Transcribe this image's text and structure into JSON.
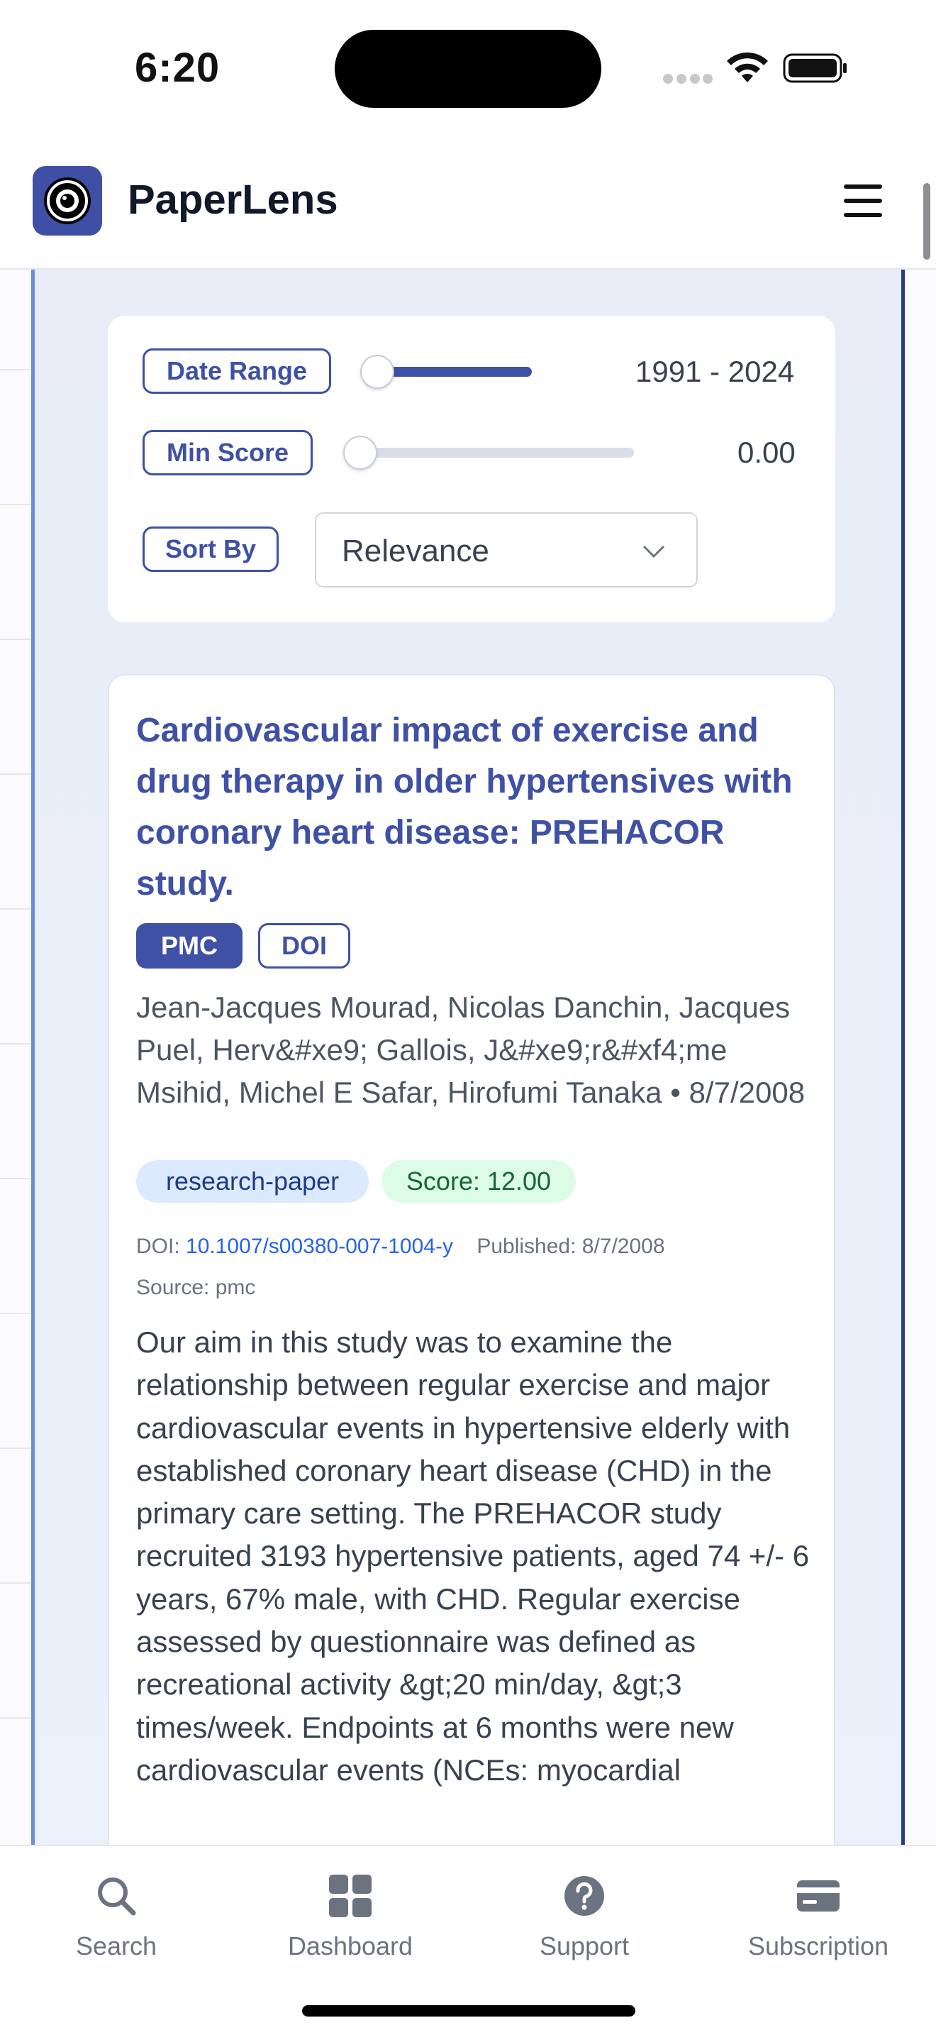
{
  "status_bar": {
    "time": "6:20"
  },
  "app": {
    "title": "PaperLens"
  },
  "filters": {
    "date_range": {
      "label": "Date Range",
      "value": "1991 - 2024",
      "min_fraction": 0.0,
      "max_fraction": 1.0
    },
    "min_score": {
      "label": "Min Score",
      "value": "0.00",
      "fraction": 0.0
    },
    "sort_by": {
      "label": "Sort By",
      "selected": "Relevance"
    }
  },
  "result": {
    "title": "Cardiovascular impact of exercise and drug therapy in older hypertensives with coronary heart disease: PREHACOR study.",
    "badges": {
      "primary": "PMC",
      "secondary": "DOI"
    },
    "authors": "Jean-Jacques Mourad, Nicolas Danchin, Jacques Puel, Herv&#xe9; Gallois, J&#xe9;r&#xf4;me Msihid, Michel E Safar, Hirofumi Tanaka • 8/7/2008",
    "tags": {
      "type": "research-paper",
      "score": "Score: 12.00"
    },
    "meta": {
      "doi_label": "DOI:",
      "doi_value": "10.1007/s00380-007-1004-y",
      "published": "Published: 8/7/2008",
      "source": "Source: pmc"
    },
    "abstract": "Our aim in this study was to examine the relationship between regular exercise and major cardiovascular events in hypertensive elderly with established coronary heart disease (CHD) in the primary care setting. The PREHACOR study recruited 3193 hypertensive patients, aged 74 +/- 6 years, 67% male, with CHD. Regular exercise assessed by questionnaire was defined as recreational activity &gt;20 min/day, &gt;3 times/week. Endpoints at 6 months were new cardiovascular events (NCEs: myocardial"
  },
  "tabbar": {
    "items": [
      {
        "label": "Search",
        "icon": "search-icon"
      },
      {
        "label": "Dashboard",
        "icon": "dashboard-icon"
      },
      {
        "label": "Support",
        "icon": "help-icon"
      },
      {
        "label": "Subscription",
        "icon": "card-icon"
      }
    ]
  },
  "colors": {
    "accent": "#3f51a5",
    "link": "#2563eb",
    "tag_type_bg": "#dbeafe",
    "tag_score_bg": "#dcfce7"
  }
}
